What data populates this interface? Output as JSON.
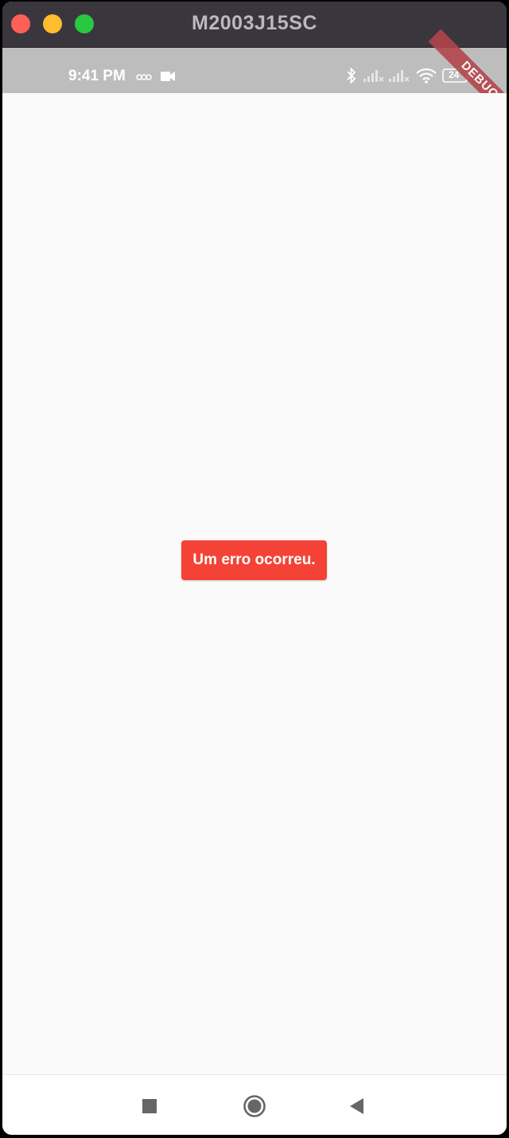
{
  "window": {
    "title": "M2003J15SC"
  },
  "status_bar": {
    "time": "9:41 PM",
    "battery": "24",
    "debug_banner": "DEBUG"
  },
  "main": {
    "error_message": "Um erro ocorreu."
  },
  "nav_bar": {
    "buttons": [
      "recents-button",
      "home-button",
      "back-button"
    ]
  },
  "colors": {
    "titlebar": "#3a363d",
    "status_bar": "#bdbdbd",
    "error_bg": "#f44336",
    "debug_banner": "#b3454c"
  }
}
